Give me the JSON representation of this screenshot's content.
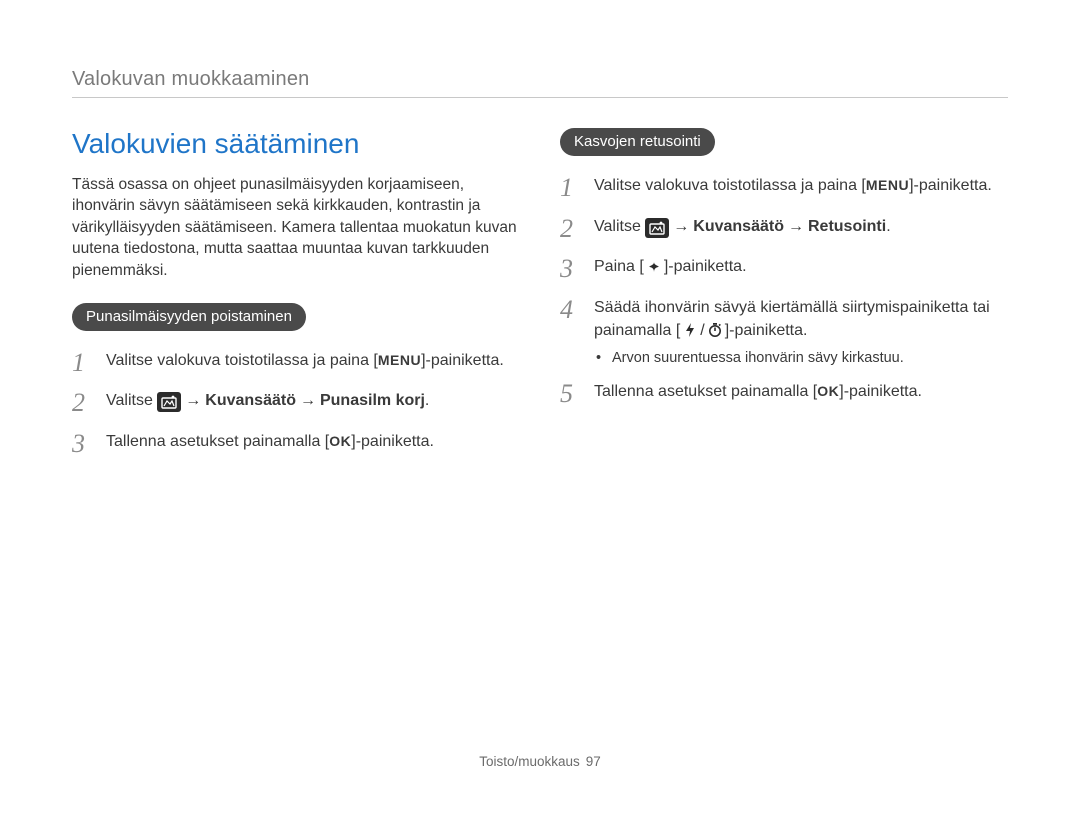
{
  "breadcrumb": "Valokuvan muokkaaminen",
  "section_title": "Valokuvien säätäminen",
  "intro": "Tässä osassa on ohjeet punasilmäisyyden korjaamiseen, ihonvärin sävyn säätämiseen sekä kirkkauden, kontrastin ja värikylläisyyden säätämiseen. Kamera tallentaa muokatun kuvan uutena tiedostona, mutta saattaa muuntaa kuvan tarkkuuden pienemmäksi.",
  "left": {
    "pill": "Punasilmäisyyden poistaminen",
    "steps": {
      "s1_a": "Valitse valokuva toistotilassa ja paina [",
      "s1_menu": "MENU",
      "s1_b": "]-painiketta.",
      "s2_a": "Valitse ",
      "s2_arrow1": "→",
      "s2_b": "Kuvansäätö",
      "s2_arrow2": "→",
      "s2_c": "Punasilm korj",
      "s2_d": ".",
      "s3_a": "Tallenna asetukset painamalla [",
      "s3_ok": "OK",
      "s3_b": "]-painiketta."
    }
  },
  "right": {
    "pill": "Kasvojen retusointi",
    "steps": {
      "s1_a": "Valitse valokuva toistotilassa ja paina [",
      "s1_menu": "MENU",
      "s1_b": "]-painiketta.",
      "s2_a": "Valitse ",
      "s2_arrow1": "→",
      "s2_b": "Kuvansäätö",
      "s2_arrow2": "→",
      "s2_c": "Retusointi",
      "s2_d": ".",
      "s3_a": "Paina [",
      "s3_b": "]-painiketta.",
      "s4_a": "Säädä ihonvärin sävyä kiertämällä siirtymispainiketta tai painamalla [",
      "s4_sep": "/",
      "s4_b": "]-painiketta.",
      "bullet": "Arvon suurentuessa ihonvärin sävy kirkastuu.",
      "s5_a": "Tallenna asetukset painamalla [",
      "s5_ok": "OK",
      "s5_b": "]-painiketta."
    }
  },
  "footer": {
    "label": "Toisto/muokkaus",
    "page": "97"
  },
  "nums": {
    "n1": "1",
    "n2": "2",
    "n3": "3",
    "n4": "4",
    "n5": "5"
  }
}
